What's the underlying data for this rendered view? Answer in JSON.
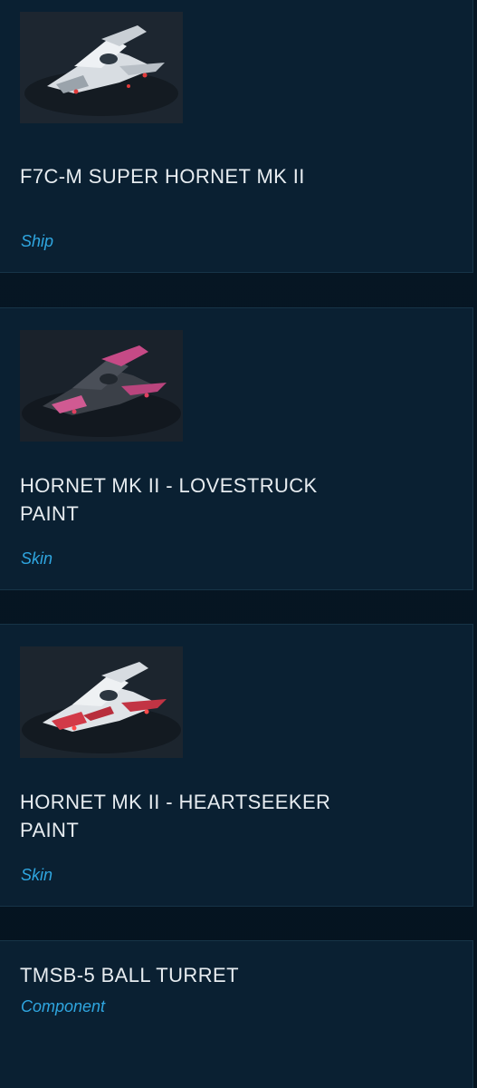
{
  "items": [
    {
      "title": "F7C-M SUPER HORNET MK II",
      "type": "Ship",
      "thumbnail_icon": "ship-white-icon"
    },
    {
      "title": "HORNET MK II - LOVESTRUCK PAINT",
      "type": "Skin",
      "thumbnail_icon": "ship-pink-icon"
    },
    {
      "title": "HORNET MK II - HEARTSEEKER PAINT",
      "type": "Skin",
      "thumbnail_icon": "ship-red-white-icon"
    },
    {
      "title": "TMSB-5 BALL TURRET",
      "type": "Component"
    }
  ],
  "colors": {
    "background": "#061522",
    "card": "#0a2032",
    "title": "#e7ecf0",
    "type_label": "#2fa6e0"
  }
}
